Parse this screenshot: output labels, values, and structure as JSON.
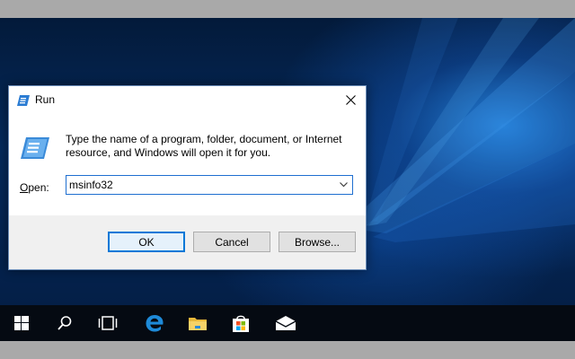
{
  "dialog": {
    "title": "Run",
    "description": "Type the name of a program, folder, document, or Internet resource, and Windows will open it for you.",
    "open_label_mnemonic": "O",
    "open_label_rest": "pen:",
    "open_value": "msinfo32",
    "ok_label": "OK",
    "cancel_label": "Cancel",
    "browse_label": "Browse..."
  },
  "taskbar": {
    "icons": [
      "windows-start-icon",
      "search-icon",
      "task-view-icon",
      "edge-icon",
      "file-explorer-icon",
      "store-icon",
      "mail-icon"
    ]
  },
  "colors": {
    "accent": "#0078d7",
    "taskbar": "#050a12",
    "desktop": "#052a5c"
  }
}
